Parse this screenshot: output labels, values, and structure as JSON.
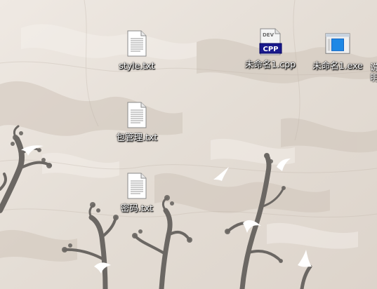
{
  "desktop": {
    "icons": [
      {
        "label": "style.txt",
        "type": "text-file-icon"
      },
      {
        "label": "包管理.txt",
        "type": "text-file-icon"
      },
      {
        "label": "密码.txt",
        "type": "text-file-icon"
      },
      {
        "label": "未命名1.cpp",
        "type": "devcpp-source-icon",
        "badge": "CPP",
        "badge_top": "DEV"
      },
      {
        "label": "未命名1.exe",
        "type": "executable-icon"
      },
      {
        "label": "说明",
        "type": "partial-label-clipped"
      }
    ],
    "wallpaper": {
      "colors": {
        "base": "#e6dfd8",
        "light": "#f1ece6",
        "dark": "#c9bfb5",
        "tree": "#6b6763",
        "bird": "#ffffff"
      }
    }
  }
}
